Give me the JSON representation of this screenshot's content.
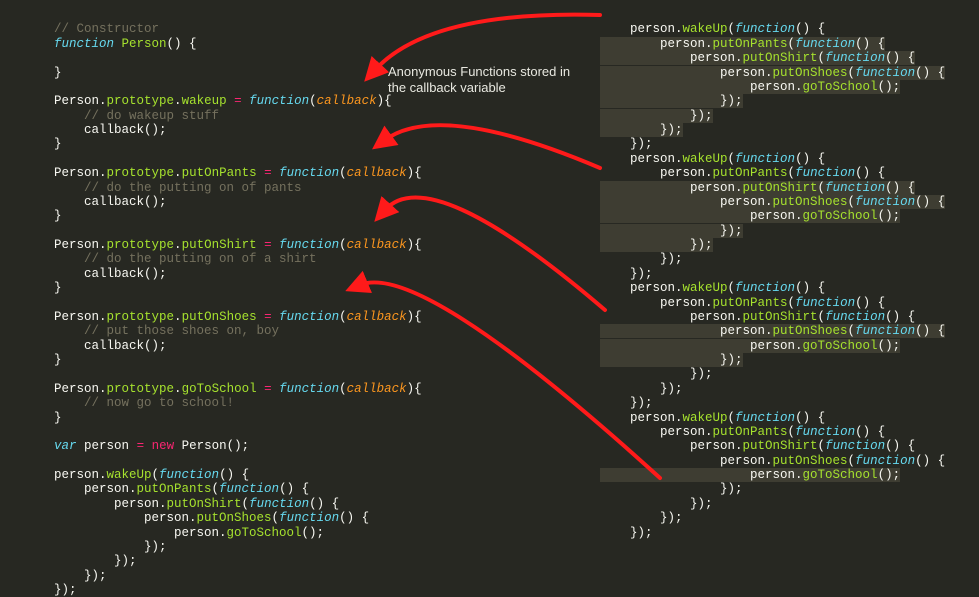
{
  "annotation": "Anonymous Functions stored in the callback variable",
  "left": {
    "l1": "// Constructor",
    "l2a": "function",
    "l2b": "Person",
    "l2c": "() {",
    "l3": "}",
    "l4a": "Person",
    "l4b": "prototype",
    "l4c": "wakeup",
    "l4d": "function",
    "l4e": "callback",
    "l4f": "){",
    "l5": "    // do wakeup stuff",
    "l6a": "    callback",
    "l6b": "();",
    "l7": "}",
    "l8a": "Person",
    "l8b": "prototype",
    "l8c": "putOnPants",
    "l8d": "function",
    "l8e": "callback",
    "l8f": "){",
    "l9": "    // do the putting on of pants",
    "l10a": "    callback",
    "l10b": "();",
    "l11": "}",
    "l12a": "Person",
    "l12b": "prototype",
    "l12c": "putOnShirt",
    "l12d": "function",
    "l12e": "callback",
    "l12f": "){",
    "l13": "    // do the putting on of a shirt",
    "l14a": "    callback",
    "l14b": "();",
    "l15": "}",
    "l16a": "Person",
    "l16b": "prototype",
    "l16c": "putOnShoes",
    "l16d": "function",
    "l16e": "callback",
    "l16f": "){",
    "l17": "    // put those shoes on, boy",
    "l18a": "    callback",
    "l18b": "();",
    "l19": "}",
    "l20a": "Person",
    "l20b": "prototype",
    "l20c": "goToSchool",
    "l20d": "function",
    "l20e": "callback",
    "l20f": "){",
    "l21": "    // now go to school!",
    "l22": "}",
    "l23a": "var",
    "l23b": "person",
    "l23c": "new",
    "l23d": "Person",
    "l23e": "();",
    "l24a": "person.",
    "l24b": "wakeUp",
    "l24c": "function",
    "l24d": "() {",
    "l25a": "    person.",
    "l25b": "putOnPants",
    "l25c": "function",
    "l25d": "() {",
    "l26a": "        person.",
    "l26b": "putOnShirt",
    "l26c": "function",
    "l26d": "() {",
    "l27a": "            person.",
    "l27b": "putOnShoes",
    "l27c": "function",
    "l27d": "() {",
    "l28a": "                person.",
    "l28b": "goToSchool",
    "l28c": "();",
    "l29": "            });",
    "l30": "        });",
    "l31": "    });",
    "l32": "});"
  },
  "right": {
    "b1": {
      "r1a": "    person.",
      "r1b": "wakeUp",
      "r1c": "function",
      "r1d": "() {",
      "r2a": "        person.",
      "r2b": "putOnPants",
      "r2c": "function",
      "r2d": "() {",
      "r3a": "            person.",
      "r3b": "putOnShirt",
      "r3c": "function",
      "r3d": "() {",
      "r4a": "                person.",
      "r4b": "putOnShoes",
      "r4c": "function",
      "r4d": "() {",
      "r5a": "                    person.",
      "r5b": "goToSchool",
      "r5c": "();",
      "r6": "                });",
      "r7": "            });",
      "r8": "        });",
      "r9": "    });"
    }
  },
  "colors": {
    "arrow": "#ff1a1a",
    "bg": "#272822"
  }
}
